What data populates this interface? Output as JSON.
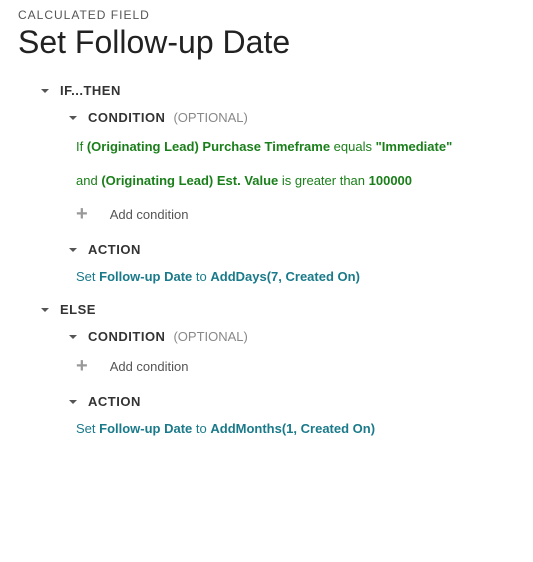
{
  "header": {
    "label": "CALCULATED FIELD",
    "title": "Set Follow-up Date"
  },
  "ifthen": {
    "label": "IF...THEN",
    "condition": {
      "label": "CONDITION",
      "optional": "(OPTIONAL)",
      "line1": {
        "prefix": "If ",
        "field": "(Originating Lead) Purchase Timeframe",
        "op": " equals ",
        "value": "\"Immediate\""
      },
      "line2": {
        "prefix": "and ",
        "field": "(Originating Lead) Est. Value",
        "op": " is greater than ",
        "value": "100000"
      },
      "add": "Add condition"
    },
    "action": {
      "label": "ACTION",
      "set": "Set ",
      "field": "Follow-up Date",
      "to": " to ",
      "func": "AddDays(7, Created On)"
    }
  },
  "else": {
    "label": "ELSE",
    "condition": {
      "label": "CONDITION",
      "optional": "(OPTIONAL)",
      "add": "Add condition"
    },
    "action": {
      "label": "ACTION",
      "set": "Set ",
      "field": "Follow-up Date",
      "to": " to ",
      "func": "AddMonths(1, Created On)"
    }
  }
}
